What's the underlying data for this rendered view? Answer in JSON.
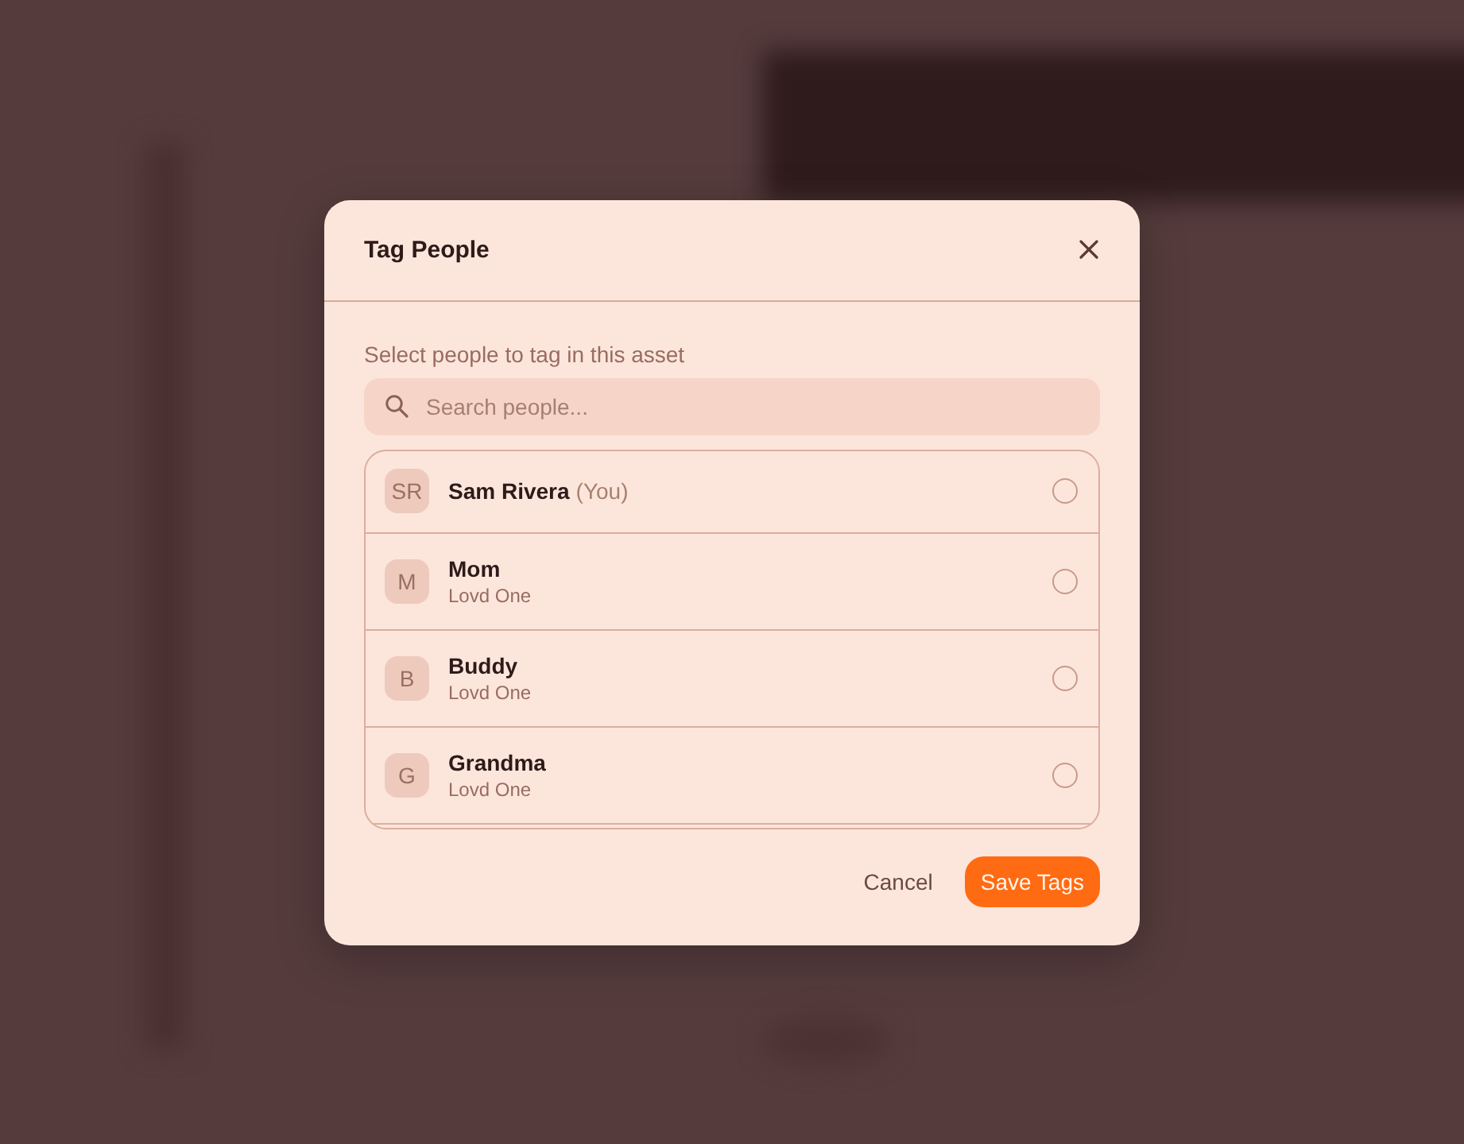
{
  "dialog": {
    "title": "Tag People",
    "instruction": "Select people to tag in this asset",
    "search": {
      "placeholder": "Search people..."
    },
    "people": [
      {
        "initials": "SR",
        "name": "Sam Rivera",
        "note": "(You)",
        "selected": false
      },
      {
        "initials": "M",
        "name": "Mom",
        "relation": "Lovd One",
        "selected": false
      },
      {
        "initials": "B",
        "name": "Buddy",
        "relation": "Lovd One",
        "selected": false
      },
      {
        "initials": "G",
        "name": "Grandma",
        "relation": "Lovd One",
        "selected": false
      }
    ],
    "buttons": [
      {
        "label": "Cancel",
        "kind": "secondary"
      },
      {
        "label": "Save Tags",
        "kind": "primary"
      }
    ]
  }
}
